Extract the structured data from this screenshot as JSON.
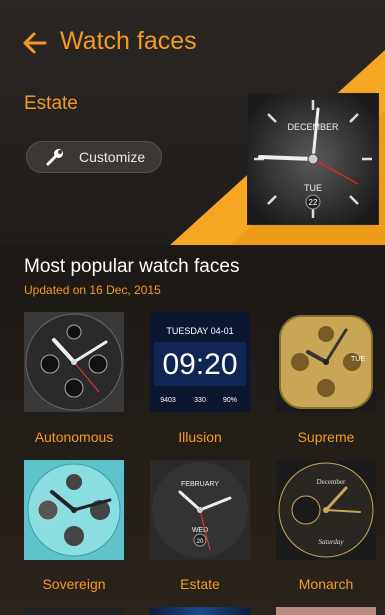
{
  "header": {
    "title": "Watch faces",
    "back_icon": "arrow-left-icon"
  },
  "current": {
    "name": "Estate",
    "customize_label": "Customize",
    "customize_icon": "wrench-icon",
    "month": "DECEMBER",
    "day": "TUE",
    "date": "22"
  },
  "popular": {
    "title": "Most popular watch faces",
    "updated": "Updated on 16 Dec, 2015",
    "faces": [
      {
        "name": "Autonomous"
      },
      {
        "name": "Illusion",
        "date_line": "TUESDAY 04-01",
        "time": "09:20",
        "stats": [
          "9403",
          "330",
          "90%"
        ]
      },
      {
        "name": "Supreme",
        "day": "TUE"
      },
      {
        "name": "Sovereign"
      },
      {
        "name": "Estate",
        "month": "FEBRUARY",
        "day": "WED",
        "date": "20"
      },
      {
        "name": "Monarch",
        "month": "December",
        "weekday": "Saturday"
      }
    ]
  },
  "colors": {
    "accent": "#f39a22",
    "background": "#1a1613"
  }
}
